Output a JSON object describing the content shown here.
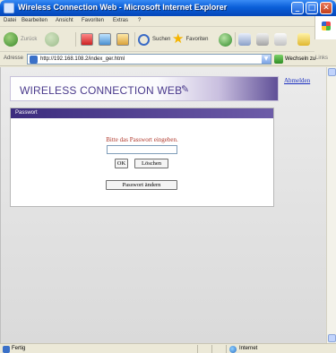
{
  "window": {
    "title": "Wireless Connection Web - Microsoft Internet Explorer",
    "controls": {
      "minimize": "_",
      "maximize": "□",
      "close": "✕"
    }
  },
  "menu": {
    "items": [
      "Datei",
      "Bearbeiten",
      "Ansicht",
      "Favoriten",
      "Extras",
      "?"
    ]
  },
  "toolbar": {
    "back_label": "Zurück",
    "search_label": "Suchen",
    "favorites_label": "Favoriten"
  },
  "address": {
    "label": "Adresse",
    "url": "http://192.168.108.2/index_ger.html",
    "go_label": "Wechseln zu",
    "links_label": "Links"
  },
  "page": {
    "banner_title": "WIRELESS CONNECTION WEB",
    "logout_link": "Abmelden",
    "panel_title": "Passwort",
    "prompt": "Bitte das Passwort eingeben.",
    "password_value": "",
    "ok_button": "OK",
    "delete_button": "Löschen",
    "change_password_button": "Passwort ändern"
  },
  "status": {
    "left_text": "Fertig",
    "zone_text": "Internet"
  },
  "colors": {
    "titlebar_blue": "#0a5fd8",
    "banner_purple": "#4a3a8c",
    "panel_header": "#3c2c7e",
    "prompt_red": "#b03a2e",
    "link_blue": "#1a2fbf"
  }
}
